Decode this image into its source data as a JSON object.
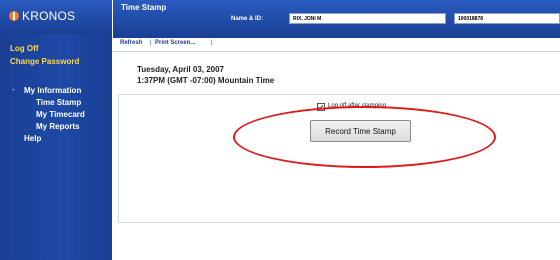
{
  "sidebar": {
    "logo_text": "KRONOS",
    "log_off": "Log Off",
    "change_password": "Change Password",
    "section_dash": "-",
    "my_information": "My Information",
    "items": [
      {
        "label": "Time Stamp"
      },
      {
        "label": "My Timecard"
      },
      {
        "label": "My Reports"
      }
    ],
    "help": "Help"
  },
  "collapse_label": "I",
  "header": {
    "title": "Time Stamp",
    "name_label": "Name & ID:",
    "name_value": "RIX, JONI M",
    "id_value": "100018878"
  },
  "toolbar": {
    "refresh": "Refresh",
    "separator": "|",
    "print": "Print Screen..."
  },
  "main": {
    "date": "Tuesday, April 03, 2007",
    "time": "1:37PM (GMT -07:00) Mountain Time",
    "logoff_label": "Log off after stamping",
    "logoff_checked": true,
    "record_button": "Record Time Stamp"
  },
  "colors": {
    "brand_blue": "#1a3f94",
    "link_yellow": "#ffd84a",
    "highlight_red": "#e01818",
    "logo_orange": "#f47920"
  }
}
